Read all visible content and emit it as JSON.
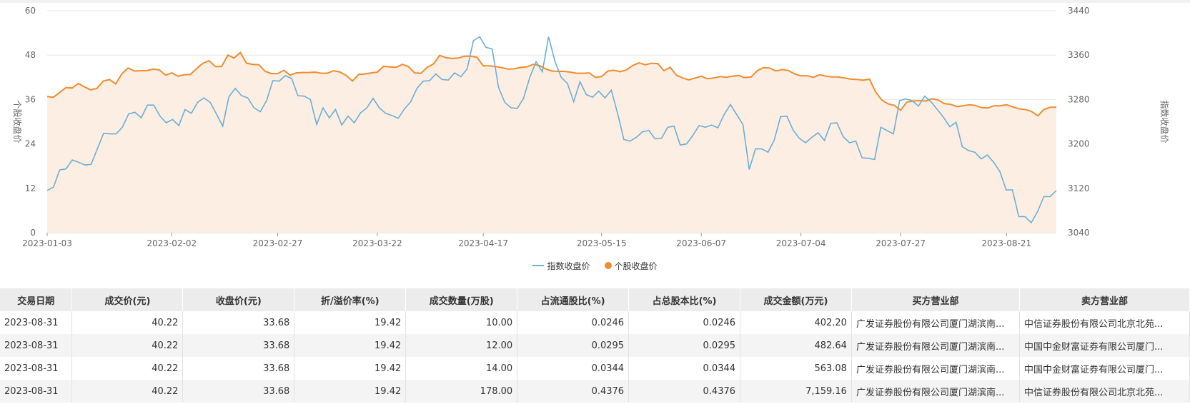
{
  "chart_data": {
    "type": "line",
    "x_tick_labels": [
      "2023-01-03",
      "2023-02-02",
      "2023-02-27",
      "2023-03-22",
      "2023-04-17",
      "2023-05-15",
      "2023-06-07",
      "2023-07-04",
      "2023-07-27",
      "2023-08-21"
    ],
    "y_left": {
      "label": "个股收盘价",
      "ticks": [
        0,
        12,
        24,
        36,
        48,
        60
      ],
      "range": [
        0,
        60
      ]
    },
    "y_right": {
      "label": "指数收盘价",
      "ticks": [
        3040,
        3120,
        3200,
        3280,
        3360,
        3440
      ],
      "range": [
        3040,
        3440
      ]
    },
    "grid": true,
    "legend_position": "bottom",
    "series": [
      {
        "name": "指数收盘价",
        "axis": "right",
        "color": "#6baed6",
        "values": [
          3116,
          3122,
          3153,
          3155,
          3171,
          3167,
          3162,
          3163,
          3191,
          3219,
          3218,
          3218,
          3230,
          3254,
          3257,
          3247,
          3270,
          3270,
          3250,
          3238,
          3244,
          3233,
          3262,
          3255,
          3275,
          3283,
          3275,
          3254,
          3232,
          3285,
          3300,
          3287,
          3283,
          3265,
          3258,
          3278,
          3314,
          3313,
          3323,
          3318,
          3287,
          3286,
          3280,
          3235,
          3265,
          3247,
          3262,
          3234,
          3250,
          3238,
          3256,
          3265,
          3282,
          3265,
          3255,
          3251,
          3246,
          3263,
          3276,
          3300,
          3313,
          3314,
          3326,
          3316,
          3315,
          3328,
          3321,
          3335,
          3386,
          3393,
          3374,
          3371,
          3302,
          3275,
          3265,
          3264,
          3282,
          3320,
          3348,
          3330,
          3393,
          3349,
          3320,
          3309,
          3276,
          3312,
          3289,
          3284,
          3295,
          3283,
          3297,
          3255,
          3208,
          3205,
          3212,
          3222,
          3224,
          3209,
          3210,
          3230,
          3232,
          3198,
          3200,
          3215,
          3233,
          3230,
          3234,
          3229,
          3253,
          3271,
          3253,
          3235,
          3154,
          3191,
          3191,
          3185,
          3207,
          3249,
          3250,
          3225,
          3210,
          3202,
          3212,
          3220,
          3206,
          3237,
          3238,
          3213,
          3202,
          3205,
          3175,
          3174,
          3172,
          3230,
          3224,
          3218,
          3278,
          3281,
          3278,
          3268,
          3286,
          3276,
          3262,
          3248,
          3231,
          3239,
          3195,
          3188,
          3185,
          3173,
          3180,
          3167,
          3150,
          3117,
          3117,
          3069,
          3069,
          3058,
          3078,
          3105,
          3105,
          3116
        ]
      },
      {
        "name": "个股收盘价",
        "axis": "left",
        "color": "#f08c2e",
        "values": [
          36.8,
          36.6,
          37.9,
          39.2,
          39.1,
          40.3,
          39.4,
          38.6,
          39.0,
          41.0,
          41.4,
          40.2,
          43.0,
          44.5,
          43.7,
          43.8,
          43.8,
          44.2,
          44.0,
          42.6,
          43.2,
          42.3,
          42.7,
          42.8,
          44.4,
          45.8,
          46.5,
          44.9,
          44.9,
          48.0,
          47.2,
          48.7,
          45.8,
          45.5,
          45.4,
          43.6,
          43.0,
          43.0,
          43.9,
          42.6,
          43.2,
          43.3,
          43.3,
          43.4,
          43.1,
          43.1,
          43.8,
          43.4,
          42.5,
          41.0,
          42.8,
          42.9,
          43.2,
          43.4,
          45.0,
          44.8,
          44.7,
          45.5,
          44.9,
          43.2,
          43.1,
          44.7,
          45.6,
          47.9,
          47.3,
          47.1,
          47.2,
          47.7,
          47.7,
          47.4,
          45.1,
          45.1,
          44.9,
          44.6,
          44.2,
          44.3,
          44.7,
          44.8,
          45.5,
          45.2,
          44.3,
          43.7,
          43.6,
          43.6,
          43.4,
          43.1,
          43.1,
          43.2,
          42.0,
          42.2,
          43.7,
          43.9,
          43.5,
          44.0,
          45.2,
          45.9,
          45.4,
          45.8,
          45.7,
          43.8,
          44.7,
          42.6,
          41.8,
          41.3,
          41.8,
          42.3,
          41.6,
          41.8,
          42.2,
          42.0,
          42.3,
          42.5,
          41.9,
          42.1,
          43.8,
          44.6,
          44.5,
          43.7,
          44.1,
          43.8,
          42.9,
          42.4,
          42.4,
          42.0,
          42.7,
          42.3,
          42.1,
          42.1,
          41.8,
          41.5,
          41.4,
          41.2,
          41.5,
          38.0,
          35.8,
          34.8,
          34.4,
          33.1,
          35.3,
          35.6,
          35.7,
          35.6,
          36.2,
          35.9,
          34.9,
          34.7,
          34.1,
          34.3,
          34.6,
          34.4,
          33.8,
          33.7,
          34.3,
          34.3,
          34.6,
          34.0,
          33.5,
          33.3,
          32.8,
          31.6,
          33.3,
          33.9,
          33.9
        ]
      }
    ]
  },
  "legend": {
    "index_label": "指数收盘价",
    "stock_label": "个股收盘价"
  },
  "colors": {
    "index_line": "#6baed6",
    "stock_line": "#f08c2e",
    "stock_fill": "#fdeee3",
    "grid": "#e6e6e6"
  },
  "table": {
    "headers": [
      "交易日期",
      "成交价(元)",
      "收盘价(元)",
      "折/溢价率(%)",
      "成交数量(万股)",
      "占流通股比(%)",
      "占总股本比(%)",
      "成交金额(万元)",
      "买方营业部",
      "卖方营业部"
    ],
    "rows": [
      [
        "2023-08-31",
        "40.22",
        "33.68",
        "19.42",
        "10.00",
        "0.0246",
        "0.0246",
        "402.20",
        "广发证券股份有限公司厦门湖滨南...",
        "中信证券股份有限公司北京北苑..."
      ],
      [
        "2023-08-31",
        "40.22",
        "33.68",
        "19.42",
        "12.00",
        "0.0295",
        "0.0295",
        "482.64",
        "广发证券股份有限公司厦门湖滨南...",
        "中国中金财富证券有限公司厦门..."
      ],
      [
        "2023-08-31",
        "40.22",
        "33.68",
        "19.42",
        "14.00",
        "0.0344",
        "0.0344",
        "563.08",
        "广发证券股份有限公司厦门湖滨南...",
        "中国中金财富证券有限公司厦门..."
      ],
      [
        "2023-08-31",
        "40.22",
        "33.68",
        "19.42",
        "178.00",
        "0.4376",
        "0.4376",
        "7,159.16",
        "广发证券股份有限公司厦门湖滨南...",
        "中信证券股份有限公司北京北苑..."
      ]
    ]
  }
}
